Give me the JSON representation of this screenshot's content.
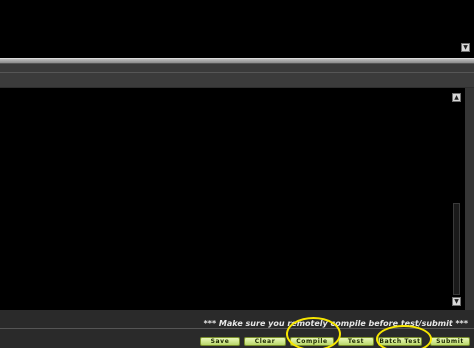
{
  "output_pane": {
    "scroll_down_icon": "chevron-down-icon"
  },
  "editor": {
    "content": ""
  },
  "status": {
    "message": "*** Make sure you remotely compile before test/submit ***"
  },
  "buttons": {
    "save": "Save",
    "clear": "Clear",
    "compile": "Compile",
    "test": "Test",
    "batch_test": "Batch Test",
    "submit": "Submit"
  },
  "colors": {
    "button_gradient_top": "#e9f7b8",
    "button_gradient_bottom": "#b9d86a",
    "highlight": "#f7e600",
    "editor_background": "#000000"
  }
}
